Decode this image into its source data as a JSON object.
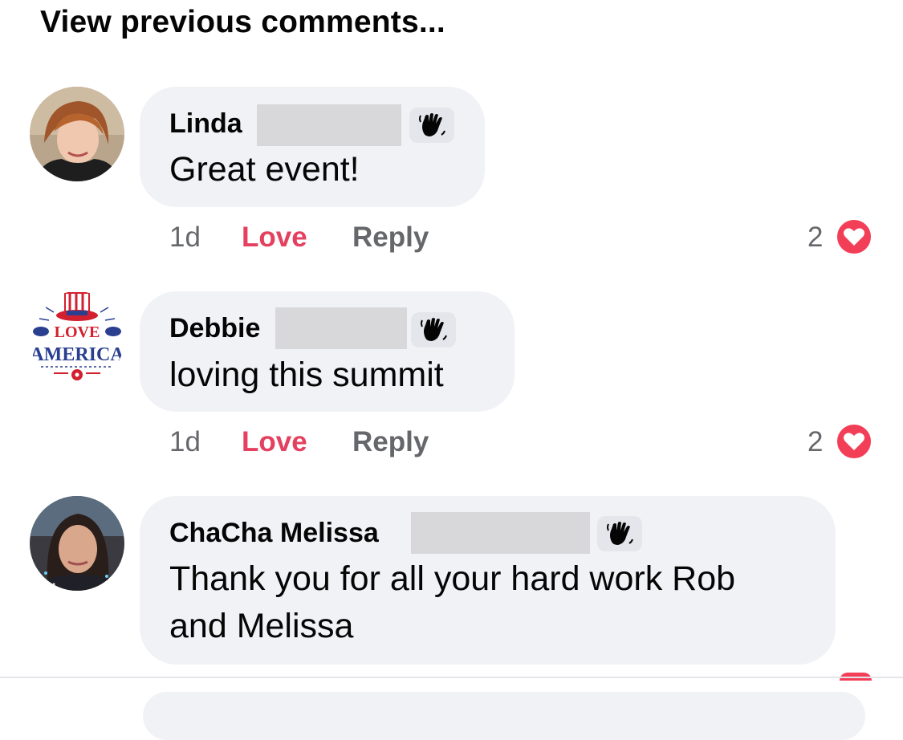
{
  "header": {
    "view_previous": "View previous comments..."
  },
  "comments": [
    {
      "author": "Linda",
      "text_lines": [
        "Great event!"
      ],
      "time": "1d",
      "love_label": "Love",
      "reply_label": "Reply",
      "reaction_count": "2",
      "badge_icon": "waving-hand-icon",
      "reaction_icon": "heart-icon"
    },
    {
      "author": "Debbie",
      "text_lines": [
        "loving this summit"
      ],
      "time": "1d",
      "love_label": "Love",
      "reply_label": "Reply",
      "reaction_count": "2",
      "avatar_text": [
        "LOVE",
        "AMERICA"
      ],
      "badge_icon": "waving-hand-icon",
      "reaction_icon": "heart-icon"
    },
    {
      "author": "ChaCha Melissa",
      "text_lines": [
        "Thank you for all your hard work Rob",
        "and Melissa"
      ],
      "badge_icon": "waving-hand-icon"
    }
  ],
  "colors": {
    "love_text": "#e4405f",
    "heart_bg": "#f33e58",
    "bubble_bg": "#f0f2f5",
    "meta_gray": "#65676b"
  }
}
